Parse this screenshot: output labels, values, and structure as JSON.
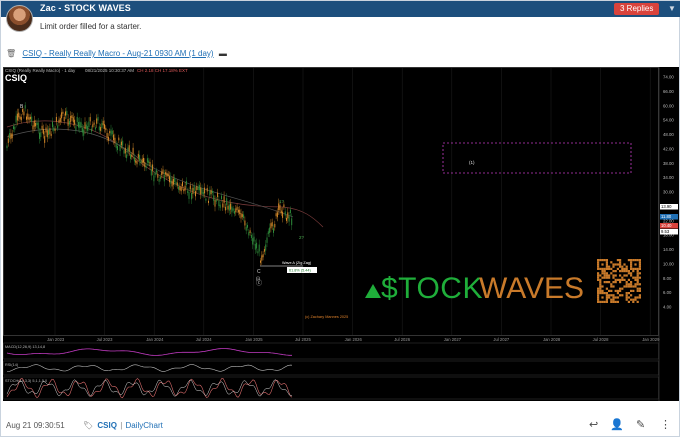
{
  "post": {
    "author_title": "Zac - STOCK WAVES",
    "message": "Limit order filled for a starter.",
    "replies_label": "3 Replies",
    "replies_chevron": "▼",
    "attachment": {
      "icon": "trash-icon",
      "link_text": "CSIQ - Really Really Macro - Aug-21 0930 AM (1 day)",
      "suffix": "▬"
    },
    "timestamp": "Aug 21 09:30:51",
    "tags": [
      {
        "label": "CSIQ"
      },
      {
        "label": "DailyChart"
      }
    ],
    "tag_separator": "|",
    "actions": {
      "reply": "↩",
      "user_add": "👤",
      "edit": "✎",
      "more": "⋮"
    }
  },
  "chart": {
    "symbol": "CSIQ",
    "header_text": "CSIQ (Really Really Macro) · 1 day",
    "date_text": "08/21/2025 10:30:37 AM",
    "change_text": "CH 2.18 CH 17.18% EXT",
    "price_axis": [
      "74.00",
      "66.00",
      "60.00",
      "54.00",
      "48.00",
      "42.00",
      "38.00",
      "34.00",
      "30.00",
      "26.00",
      "22.00",
      "18.00",
      "14.00",
      "10.00",
      "8.00",
      "6.00",
      "4.00"
    ],
    "price_tags": [
      "13.90",
      "11.80",
      "10.40",
      "9.53"
    ],
    "time_axis": [
      "Jan 2023",
      "Jul 2023",
      "Jan 2024",
      "Jul 2024",
      "Jan 2025",
      "Jul 2025",
      "Jan 2026",
      "Jul 2026",
      "Jan 2027",
      "Jul 2027",
      "Jan 2028",
      "Jul 2028",
      "Jan 2029"
    ],
    "wave_labels": {
      "b": "B",
      "c": "C",
      "i": "(i)",
      "ii": "(ii)",
      "one": "1?",
      "two": "2?",
      "circle": "ⓒ",
      "target": "(1)"
    },
    "annotation": {
      "title": "Wave A (Zig Zag)",
      "value": "61.8% (5.44)"
    },
    "copyright": "(c) Zachary Mannes 2025",
    "logo": {
      "prefix": "$TOCK",
      "suffix": "WAVES"
    },
    "indicator_labels": [
      "MACD(12,26,9) 13,14,8",
      "RSI(14)",
      "STOCH(14,3,3) 5,1,1,5,0"
    ]
  }
}
